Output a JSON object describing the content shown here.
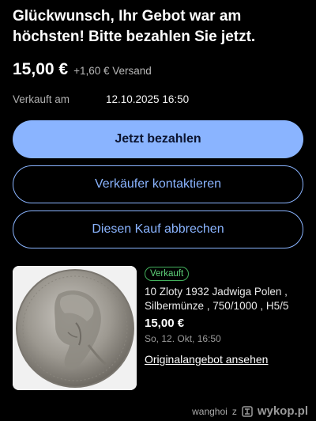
{
  "header": {
    "title": "Glückwunsch, Ihr Gebot war am höchsten! Bitte bezahlen Sie jetzt."
  },
  "price": {
    "amount": "15,00 €",
    "shipping": "+1,60 € Versand"
  },
  "sold": {
    "label": "Verkauft am",
    "value": "12.10.2025 16:50"
  },
  "actions": {
    "pay_label": "Jetzt bezahlen",
    "contact_label": "Verkäufer kontaktieren",
    "cancel_label": "Diesen Kauf abbrechen"
  },
  "item": {
    "badge": "Verkauft",
    "title": "10 Zloty 1932  Jadwiga Polen , Silbermünze , 750/1000 , H5/5",
    "price": "15,00 €",
    "date": "So, 12. Okt, 16:50",
    "link_label": "Originalangebot ansehen"
  },
  "footer": {
    "user": "wanghoi",
    "user_letter": "z",
    "brand": "wykop.pl"
  },
  "colors": {
    "accent": "#8ab4ff",
    "badge_green": "#43b05c",
    "background": "#000000"
  }
}
